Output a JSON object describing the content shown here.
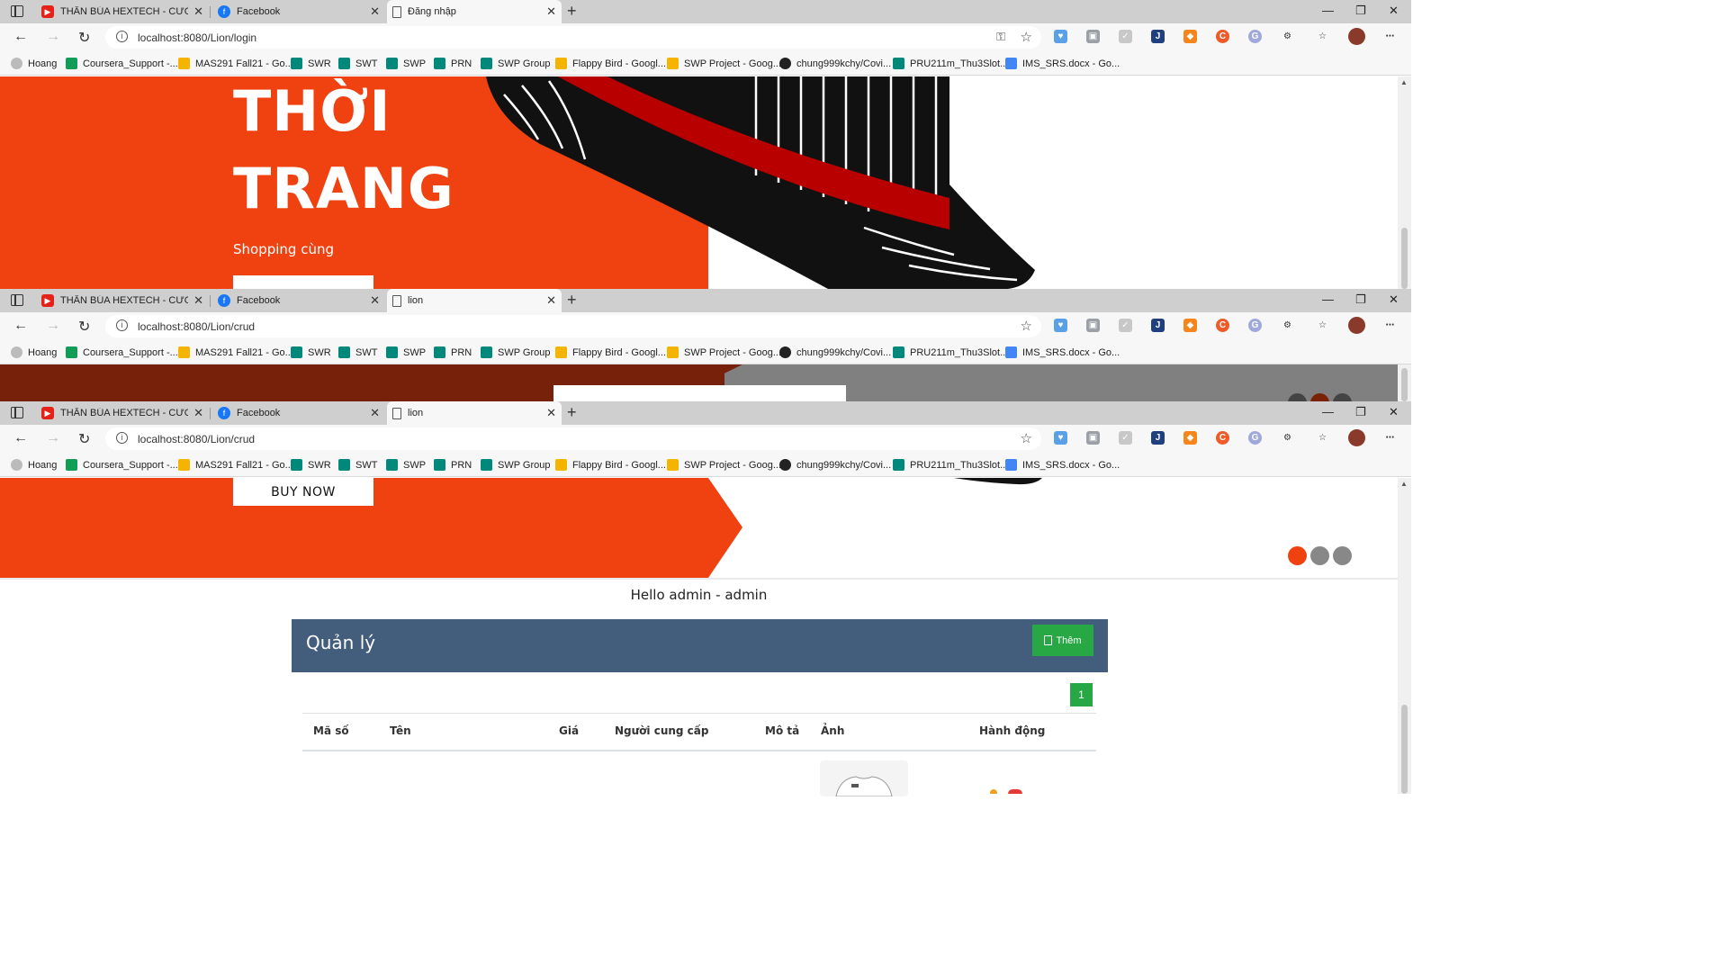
{
  "tabs": [
    {
      "title": "THẦN BÚA HEXTECH - CƯỜNG",
      "icon": "youtube-icon"
    },
    {
      "title": "Facebook",
      "icon": "facebook-icon"
    }
  ],
  "windows": [
    {
      "active_tab_title": "Đăng nhập",
      "url": "localhost:8080/Lion/login"
    },
    {
      "active_tab_title": "lion",
      "url": "localhost:8080/Lion/crud"
    },
    {
      "active_tab_title": "lion",
      "url": "localhost:8080/Lion/crud"
    }
  ],
  "bookmarks": [
    "Hoang",
    "Coursera_Support -...",
    "MAS291 Fall21 - Go...",
    "SWR",
    "SWT",
    "SWP",
    "PRN",
    "SWP Group",
    "Flappy Bird - Googl...",
    "SWP Project - Goog...",
    "chung999kchy/Covi...",
    "PRU211m_Thu3Slot...",
    "IMS_SRS.docx - Go..."
  ],
  "hero": {
    "line1": "THỜI",
    "line2": "TRANG",
    "subtitle": "Shopping cùng",
    "cta": "BUY NOW"
  },
  "colors": {
    "brand": "#ef4210",
    "header_bar": "#435d7d",
    "success": "#28a745"
  },
  "carousel": {
    "active_index": 0,
    "dots": 3
  },
  "greeting": "Hello admin - admin",
  "manager": {
    "title": "Quản lý",
    "add_label": "Thêm",
    "pagination": [
      "1"
    ],
    "columns": [
      "Mã số",
      "Tên",
      "Giá",
      "Người cung cấp",
      "Mô tả",
      "Ảnh",
      "Hành động"
    ]
  }
}
